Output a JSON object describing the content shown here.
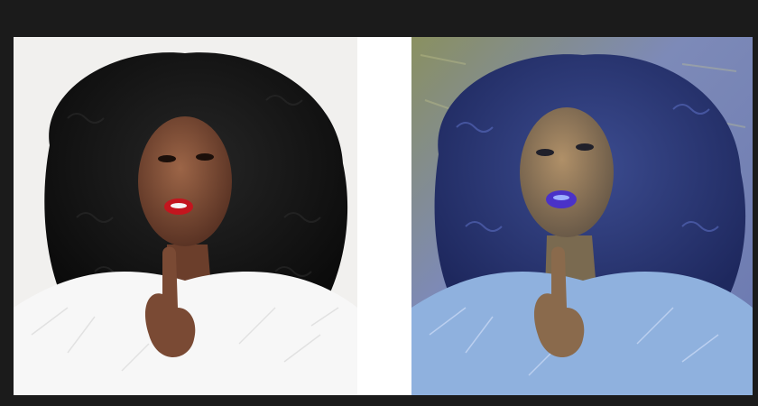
{
  "images": [
    {
      "id": "original",
      "description_icon": "portrait-photo",
      "palette": {
        "background": "#f1f0ee",
        "hair": "#141414",
        "skin": "#7a4a34",
        "lips": "#c3151e",
        "feathers": "#f7f7f7"
      }
    },
    {
      "id": "stylized",
      "description_icon": "portrait-painting",
      "palette": {
        "background": "#7d8ab8",
        "hair": "#2d3a7a",
        "skin": "#9a7a58",
        "lips": "#4a32c8",
        "feathers": "#8fb1de"
      }
    }
  ]
}
